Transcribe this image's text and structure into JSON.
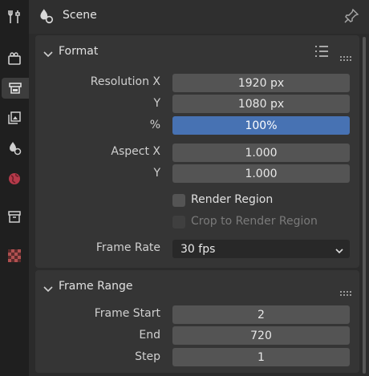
{
  "header": {
    "title": "Scene"
  },
  "sidebar": {
    "tabs": [
      {
        "icon": "tool-icon"
      },
      {
        "icon": "render-icon"
      },
      {
        "icon": "output-icon",
        "active": true
      },
      {
        "icon": "view-layer-icon"
      },
      {
        "icon": "scene-icon"
      },
      {
        "icon": "world-icon"
      },
      {
        "icon": "collection-icon"
      },
      {
        "icon": "texture-icon"
      }
    ]
  },
  "format_panel": {
    "title": "Format",
    "resolution_x_label": "Resolution X",
    "resolution_x": "1920 px",
    "resolution_y_label": "Y",
    "resolution_y": "1080 px",
    "percent_label": "%",
    "percent": "100%",
    "aspect_x_label": "Aspect X",
    "aspect_x": "1.000",
    "aspect_y_label": "Y",
    "aspect_y": "1.000",
    "render_region_label": "Render Region",
    "crop_label": "Crop to Render Region",
    "frame_rate_label": "Frame Rate",
    "frame_rate": "30 fps"
  },
  "frame_range_panel": {
    "title": "Frame Range",
    "frame_start_label": "Frame Start",
    "frame_start": "2",
    "end_label": "End",
    "end": "720",
    "step_label": "Step",
    "step": "1"
  },
  "colors": {
    "accent": "#4772b3",
    "field": "#545454",
    "panel": "#353535"
  }
}
